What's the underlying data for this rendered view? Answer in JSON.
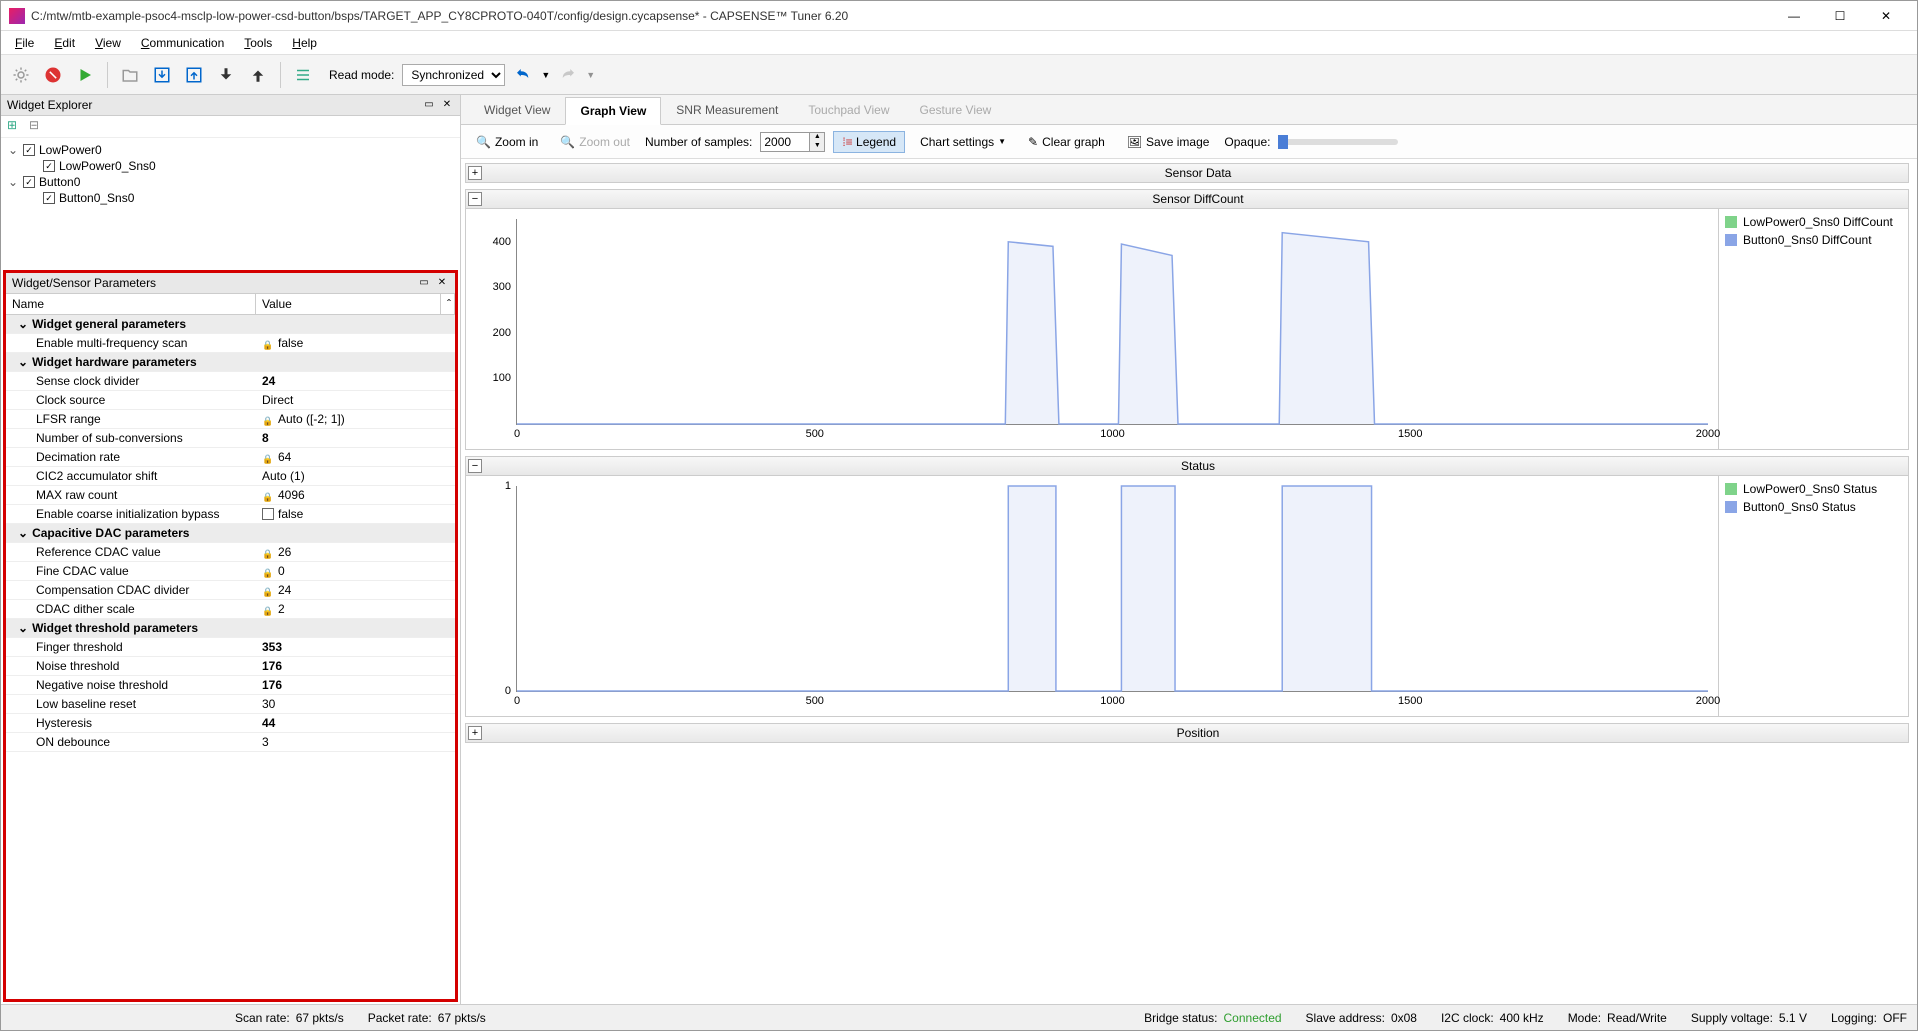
{
  "title": "C:/mtw/mtb-example-psoc4-msclp-low-power-csd-button/bsps/TARGET_APP_CY8CPROTO-040T/config/design.cycapsense* - CAPSENSE™ Tuner 6.20",
  "menu": {
    "file": "File",
    "edit": "Edit",
    "view": "View",
    "comm": "Communication",
    "tools": "Tools",
    "help": "Help"
  },
  "read_mode": {
    "label": "Read mode:",
    "value": "Synchronized"
  },
  "tabs": {
    "widget": "Widget View",
    "graph": "Graph View",
    "snr": "SNR Measurement",
    "touchpad": "Touchpad View",
    "gesture": "Gesture View"
  },
  "graph_toolbar": {
    "zoom_in": "Zoom in",
    "zoom_out": "Zoom out",
    "samples_label": "Number of samples:",
    "samples": "2000",
    "legend": "Legend",
    "chart_settings": "Chart settings",
    "clear": "Clear graph",
    "save": "Save image",
    "opaque": "Opaque:"
  },
  "explorer": {
    "title": "Widget Explorer",
    "items": [
      {
        "label": "LowPower0",
        "children": [
          {
            "label": "LowPower0_Sns0"
          }
        ]
      },
      {
        "label": "Button0",
        "children": [
          {
            "label": "Button0_Sns0"
          }
        ]
      }
    ]
  },
  "params_panel": {
    "title": "Widget/Sensor Parameters",
    "col_name": "Name",
    "col_value": "Value",
    "groups": [
      {
        "title": "Widget general parameters",
        "rows": [
          {
            "name": "Enable multi-frequency scan",
            "value": "false",
            "locked": true
          }
        ]
      },
      {
        "title": "Widget hardware parameters",
        "rows": [
          {
            "name": "Sense clock divider",
            "value": "24",
            "bold": true
          },
          {
            "name": "Clock source",
            "value": "Direct"
          },
          {
            "name": "LFSR range",
            "value": "Auto ([-2; 1])",
            "locked": true
          },
          {
            "name": "Number of sub-conversions",
            "value": "8",
            "bold": true
          },
          {
            "name": "Decimation rate",
            "value": "64",
            "locked": true
          },
          {
            "name": "CIC2 accumulator shift",
            "value": "Auto (1)"
          },
          {
            "name": "MAX raw count",
            "value": "4096",
            "locked": true
          },
          {
            "name": "Enable coarse initialization bypass",
            "value": "false",
            "checkbox": true
          }
        ]
      },
      {
        "title": "Capacitive DAC parameters",
        "rows": [
          {
            "name": "Reference CDAC value",
            "value": "26",
            "locked": true
          },
          {
            "name": "Fine CDAC value",
            "value": "0",
            "locked": true
          },
          {
            "name": "Compensation CDAC divider",
            "value": "24",
            "locked": true
          },
          {
            "name": "CDAC dither scale",
            "value": "2",
            "locked": true
          }
        ]
      },
      {
        "title": "Widget threshold parameters",
        "rows": [
          {
            "name": "Finger threshold",
            "value": "353",
            "bold": true
          },
          {
            "name": "Noise threshold",
            "value": "176",
            "bold": true
          },
          {
            "name": "Negative noise threshold",
            "value": "176",
            "bold": true
          },
          {
            "name": "Low baseline reset",
            "value": "30"
          },
          {
            "name": "Hysteresis",
            "value": "44",
            "bold": true
          },
          {
            "name": "ON debounce",
            "value": "3"
          }
        ]
      }
    ]
  },
  "charts": {
    "sensor_data": {
      "title": "Sensor Data"
    },
    "diffcount": {
      "title": "Sensor DiffCount",
      "legend": [
        {
          "color": "#7fd38a",
          "label": "LowPower0_Sns0 DiffCount"
        },
        {
          "color": "#8aa5e6",
          "label": "Button0_Sns0 DiffCount"
        }
      ]
    },
    "status": {
      "title": "Status",
      "legend": [
        {
          "color": "#7fd38a",
          "label": "LowPower0_Sns0 Status"
        },
        {
          "color": "#8aa5e6",
          "label": "Button0_Sns0 Status"
        }
      ]
    },
    "position": {
      "title": "Position"
    }
  },
  "chart_data": [
    {
      "type": "line",
      "title": "Sensor DiffCount",
      "xlabel": "",
      "ylabel": "",
      "x": [
        0,
        500,
        1000,
        1500,
        2000
      ],
      "ylim": [
        0,
        450
      ],
      "yticks": [
        100,
        200,
        300,
        400
      ],
      "series": [
        {
          "name": "Button0_Sns0 DiffCount",
          "color": "#8aa5e6",
          "points": [
            [
              0,
              0
            ],
            [
              820,
              0
            ],
            [
              825,
              400
            ],
            [
              900,
              390
            ],
            [
              910,
              0
            ],
            [
              1010,
              0
            ],
            [
              1015,
              395
            ],
            [
              1100,
              370
            ],
            [
              1110,
              0
            ],
            [
              1280,
              0
            ],
            [
              1285,
              420
            ],
            [
              1430,
              400
            ],
            [
              1440,
              0
            ],
            [
              2000,
              0
            ]
          ]
        }
      ]
    },
    {
      "type": "line",
      "title": "Status",
      "xlabel": "",
      "ylabel": "",
      "x": [
        0,
        500,
        1000,
        1500,
        2000
      ],
      "ylim": [
        0,
        1
      ],
      "yticks": [
        0,
        1
      ],
      "series": [
        {
          "name": "Button0_Sns0 Status",
          "color": "#8aa5e6",
          "points": [
            [
              0,
              0
            ],
            [
              825,
              0
            ],
            [
              825,
              1
            ],
            [
              905,
              1
            ],
            [
              905,
              0
            ],
            [
              1015,
              0
            ],
            [
              1015,
              1
            ],
            [
              1105,
              1
            ],
            [
              1105,
              0
            ],
            [
              1285,
              0
            ],
            [
              1285,
              1
            ],
            [
              1435,
              1
            ],
            [
              1435,
              0
            ],
            [
              2000,
              0
            ]
          ]
        }
      ]
    }
  ],
  "status": {
    "scan_rate": {
      "label": "Scan rate:",
      "value": "67 pkts/s"
    },
    "packet_rate": {
      "label": "Packet rate:",
      "value": "67 pkts/s"
    },
    "bridge": {
      "label": "Bridge status:",
      "value": "Connected"
    },
    "slave": {
      "label": "Slave address:",
      "value": "0x08"
    },
    "i2c": {
      "label": "I2C clock:",
      "value": "400 kHz"
    },
    "mode": {
      "label": "Mode:",
      "value": "Read/Write"
    },
    "supply": {
      "label": "Supply voltage:",
      "value": "5.1 V"
    },
    "logging": {
      "label": "Logging:",
      "value": "OFF"
    }
  }
}
